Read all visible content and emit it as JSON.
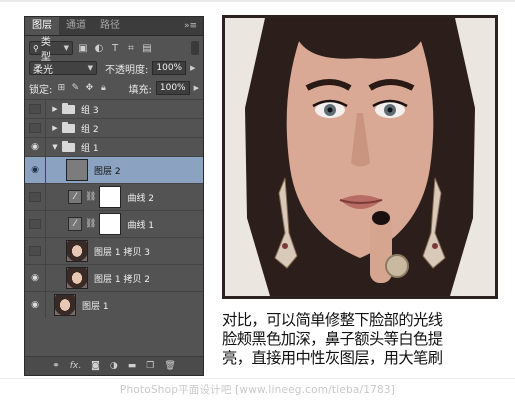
{
  "panel": {
    "tabs": [
      "图层",
      "通道",
      "路径"
    ],
    "active_tab": 0,
    "tab_menu_icon": "panel-menu-icon",
    "filter_kind": "类型",
    "filter_icons": [
      "image-filter-icon",
      "adjustment-filter-icon",
      "type-filter-icon",
      "shape-filter-icon",
      "smart-object-filter-icon"
    ],
    "blend_mode": "柔光",
    "opacity_label": "不透明度:",
    "opacity_value": "100%",
    "lock_label": "锁定:",
    "lock_icons": [
      "lock-transparent-icon",
      "lock-paint-icon",
      "lock-position-icon",
      "lock-all-icon"
    ],
    "fill_label": "填充:",
    "fill_value": "100%",
    "layers": [
      {
        "name": "组 3",
        "type": "group",
        "expanded": false,
        "visible": false
      },
      {
        "name": "组 2",
        "type": "group",
        "expanded": false,
        "visible": false
      },
      {
        "name": "组 1",
        "type": "group",
        "expanded": true,
        "visible": true
      },
      {
        "name": "图层 2",
        "type": "pixel",
        "visible": true,
        "selected": true
      },
      {
        "name": "曲线 2",
        "type": "curves",
        "visible": false
      },
      {
        "name": "曲线 1",
        "type": "curves",
        "visible": false
      },
      {
        "name": "图层 1 拷贝 3",
        "type": "pixel",
        "visible": false
      },
      {
        "name": "图层 1 拷贝 2",
        "type": "pixel",
        "visible": true
      },
      {
        "name": "图层 1",
        "type": "pixel",
        "visible": true
      }
    ],
    "bottom_icons": [
      "link-layers-icon",
      "fx-icon",
      "add-mask-icon",
      "new-adjustment-icon",
      "new-group-icon",
      "new-layer-icon",
      "delete-layer-icon"
    ]
  },
  "caption": {
    "line1": "对比，可以简单修整下脸部的光线",
    "line2": "脸颊黑色加深，鼻子额头等白色提",
    "line3": "亮，直接用中性灰图层，用大笔刷"
  },
  "footer": {
    "text": "PhotoShop平面设计吧 [www.lineeg.com/tieba/1783]"
  },
  "colors": {
    "panel_bg": "#535353",
    "selection": "#8ba3c0",
    "photo_frame": "#2b2220"
  }
}
